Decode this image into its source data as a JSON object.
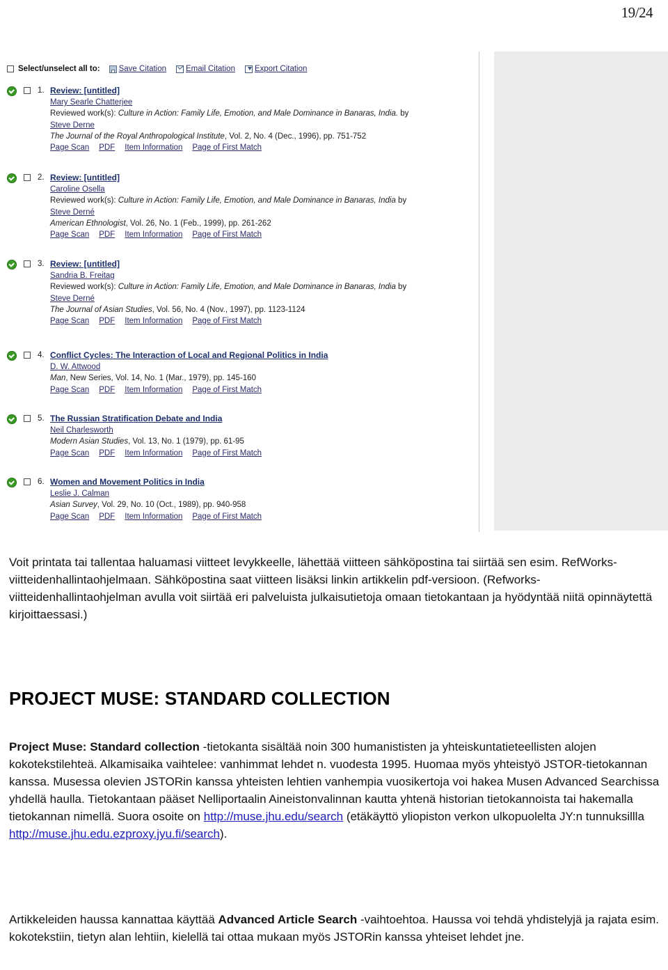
{
  "page_number": "19/24",
  "screenshot": {
    "toolbar": {
      "select_all_label": "Select/unselect all to:",
      "actions": [
        {
          "label": "Save Citation",
          "icon": "save-icon"
        },
        {
          "label": "Email Citation",
          "icon": "envelope-icon"
        },
        {
          "label": "Export Citation",
          "icon": "export-icon"
        }
      ]
    },
    "link_labels": {
      "page_scan": "Page Scan",
      "pdf": "PDF",
      "item_information": "Item Information",
      "page_of_first_match": "Page of First Match"
    },
    "results": [
      {
        "number": "1.",
        "title": "Review: [untitled]",
        "author": "Mary Searle Chatterjee",
        "reviewed_prefix": "Reviewed work(s): ",
        "reviewed_work": "Culture in Action: Family Life, Emotion, and Male Dominance in Banaras, India.",
        "reviewed_by": " by",
        "reviewed_author": "Steve Derne",
        "journal": "The Journal of the Royal Anthropological Institute",
        "citation": ", Vol. 2, No. 4 (Dec., 1996), pp. 751-752"
      },
      {
        "number": "2.",
        "title": "Review: [untitled]",
        "author": "Caroline Osella",
        "reviewed_prefix": "Reviewed work(s): ",
        "reviewed_work": "Culture in Action: Family Life, Emotion, and Male Dominance in Banaras, India",
        "reviewed_by": " by",
        "reviewed_author": "Steve Derné",
        "journal": "American Ethnologist",
        "citation": ", Vol. 26, No. 1 (Feb., 1999), pp. 261-262"
      },
      {
        "number": "3.",
        "title": "Review: [untitled]",
        "author": "Sandria B. Freitag",
        "reviewed_prefix": "Reviewed work(s): ",
        "reviewed_work": "Culture in Action: Family Life, Emotion, and Male Dominance in Banaras, India",
        "reviewed_by": " by",
        "reviewed_author": "Steve Derné",
        "journal": "The Journal of Asian Studies",
        "citation": ", Vol. 56, No. 4 (Nov., 1997), pp. 1123-1124"
      },
      {
        "number": "4.",
        "title": "Conflict Cycles: The Interaction of Local and Regional Politics in India",
        "author": "D. W. Attwood",
        "journal": "Man",
        "citation": ", New Series, Vol. 14, No. 1 (Mar., 1979), pp. 145-160"
      },
      {
        "number": "5.",
        "title": "The Russian Stratification Debate and India",
        "author": "Neil Charlesworth",
        "journal": "Modern Asian Studies",
        "citation": ", Vol. 13, No. 1 (1979), pp. 61-95"
      },
      {
        "number": "6.",
        "title": "Women and Movement Politics in India",
        "author": "Leslie J. Calman",
        "journal": "Asian Survey",
        "citation": ", Vol. 29, No. 10 (Oct., 1989), pp. 940-958"
      }
    ]
  },
  "body": {
    "paragraph_1": "Voit printata tai tallentaa haluamasi viitteet levykkeelle, lähettää viitteen sähköpostina tai siirtää sen esim. RefWorks-viitteidenhallintaohjelmaan. Sähköpostina saat viitteen lisäksi linkin artikkelin pdf-versioon.  (Refworks-viitteidenhallintaohjelman avulla voit siirtää eri palveluista julkaisutietoja omaan tietokantaan ja hyödyntää niitä opinnäytettä kirjoittaessasi.)",
    "heading": "PROJECT MUSE: STANDARD COLLECTION",
    "paragraph_2_bold": "Project Muse: Standard collection",
    "paragraph_2_part1": " -tietokanta sisältää noin 300 humanististen ja yhteiskuntatieteellisten alojen kokotekstilehteä. Alkamisaika vaihtelee: vanhimmat lehdet n. vuodesta 1995. Huomaa myös yhteistyö JSTOR-tietokannan kanssa. Musessa olevien JSTORin kanssa yhteisten lehtien vanhempia vuosikertoja voi hakea Musen Advanced Searchissa yhdellä haulla. Tietokantaan pääset Nelliportaalin Aineistonvalinnan kautta yhtenä historian tietokannoista tai hakemalla tietokannan nimellä. Suora osoite on ",
    "link_1": "http://muse.jhu.edu/search",
    "paragraph_2_part2": " (etäkäyttö yliopiston verkon ulkopuolelta JY:n tunnuksillla ",
    "link_2": "http://muse.jhu.edu.ezproxy.jyu.fi/search",
    "paragraph_2_part3": ").",
    "paragraph_3_part1": "Artikkeleiden haussa kannattaa käyttää ",
    "paragraph_3_bold": "Advanced Article Search",
    "paragraph_3_part2": " -vaihtoehtoa. Haussa voi tehdä yhdistelyjä ja rajata esim. kokotekstiin, tietyn alan lehtiin, kielellä tai ottaa mukaan myös JSTORin kanssa yhteiset lehdet jne."
  }
}
